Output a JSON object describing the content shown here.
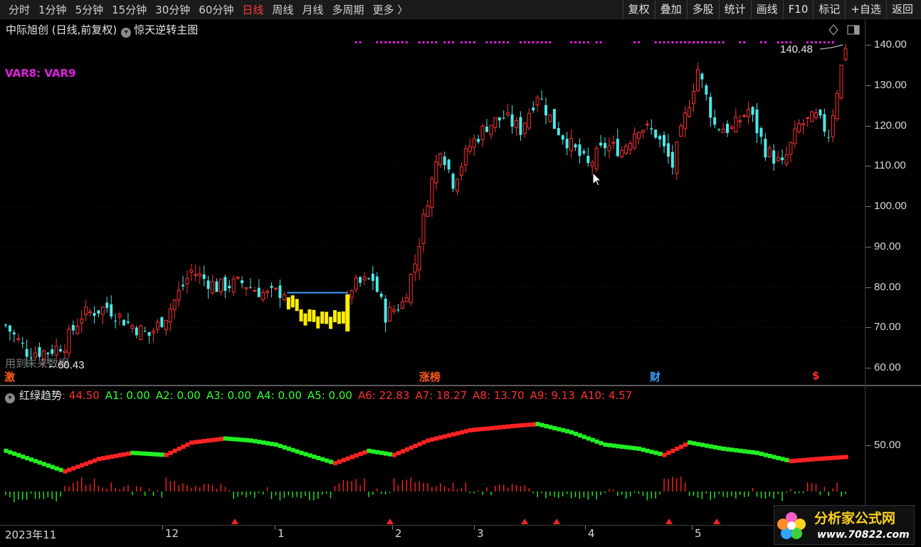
{
  "toolbar": {
    "periods": [
      "分时",
      "1分钟",
      "5分钟",
      "15分钟",
      "30分钟",
      "60分钟",
      "日线",
      "周线",
      "月线",
      "多周期",
      "更多 〉"
    ],
    "active": "日线",
    "right_buttons": [
      "复权",
      "叠加",
      "多股",
      "统计",
      "画线",
      "F10",
      "标记",
      "+自选",
      "返回"
    ]
  },
  "main": {
    "title": "中际旭创 (日线,前复权)",
    "indicator": "惊天逆转主图",
    "var_label": "VAR8:  VAR9",
    "high_label": "140.48",
    "low_label": "←60.43",
    "ghost_text": "用到未来数据",
    "events": [
      {
        "text": "激",
        "color": "#ff5a1a"
      },
      {
        "text": "涨榜",
        "color": "#ff5a1a"
      },
      {
        "text": "财",
        "color": "#3aa0ff"
      },
      {
        "text": "$",
        "color": "#ff3030"
      }
    ],
    "y_ticks": [
      "140.00",
      "130.00",
      "120.00",
      "110.00",
      "100.00",
      "90.00",
      "80.00",
      "70.00",
      "60.00"
    ]
  },
  "sub": {
    "name": "红绿趋势",
    "values": [
      {
        "k": ":",
        "v": "44.50",
        "c": "#ff3030"
      },
      {
        "k": "A1:",
        "v": "0.00",
        "c": "#30ff30"
      },
      {
        "k": "A2:",
        "v": "0.00",
        "c": "#30ff30"
      },
      {
        "k": "A3:",
        "v": "0.00",
        "c": "#30ff30"
      },
      {
        "k": "A4:",
        "v": "0.00",
        "c": "#30ff30"
      },
      {
        "k": "A5:",
        "v": "0.00",
        "c": "#30ff30"
      },
      {
        "k": "A6:",
        "v": "22.83",
        "c": "#ff3030"
      },
      {
        "k": "A7:",
        "v": "18.27",
        "c": "#ff3030"
      },
      {
        "k": "A8:",
        "v": "13.70",
        "c": "#ff3030"
      },
      {
        "k": "A9:",
        "v": "9.13",
        "c": "#ff3030"
      },
      {
        "k": "A10:",
        "v": "4.57",
        "c": "#ff3030"
      }
    ],
    "y_tick": "50.00"
  },
  "time_axis": [
    "2023年11",
    "12",
    "1",
    "2",
    "3",
    "4",
    "5"
  ],
  "colors": {
    "up": "#ff3333",
    "down": "#4ee8e8",
    "purple": "#e020e0",
    "yellow": "#ffee00",
    "green": "#22ee22",
    "red": "#ff2222"
  },
  "watermark": {
    "name": "分析家公式网",
    "url": "www.70822.com"
  },
  "chart_data": {
    "type": "candlestick",
    "y_range": [
      57,
      144
    ],
    "close_path": [
      {
        "i": 0,
        "p": 70.5
      },
      {
        "i": 5,
        "p": 64
      },
      {
        "i": 10,
        "p": 64
      },
      {
        "i": 14,
        "p": 66
      },
      {
        "i": 18,
        "p": 73
      },
      {
        "i": 24,
        "p": 75
      },
      {
        "i": 29,
        "p": 71
      },
      {
        "i": 34,
        "p": 68
      },
      {
        "i": 38,
        "p": 73
      },
      {
        "i": 44,
        "p": 84
      },
      {
        "i": 50,
        "p": 80
      },
      {
        "i": 56,
        "p": 81
      },
      {
        "i": 62,
        "p": 78
      },
      {
        "i": 66,
        "p": 79
      },
      {
        "i": 70,
        "p": 73
      },
      {
        "i": 76,
        "p": 71
      },
      {
        "i": 80,
        "p": 71
      },
      {
        "i": 82,
        "p": 80
      },
      {
        "i": 87,
        "p": 82
      },
      {
        "i": 90,
        "p": 73
      },
      {
        "i": 94,
        "p": 76
      },
      {
        "i": 97,
        "p": 86
      },
      {
        "i": 100,
        "p": 102
      },
      {
        "i": 103,
        "p": 115
      },
      {
        "i": 106,
        "p": 106
      },
      {
        "i": 110,
        "p": 115
      },
      {
        "i": 114,
        "p": 120
      },
      {
        "i": 118,
        "p": 122
      },
      {
        "i": 122,
        "p": 119
      },
      {
        "i": 126,
        "p": 128
      },
      {
        "i": 130,
        "p": 120
      },
      {
        "i": 134,
        "p": 115
      },
      {
        "i": 138,
        "p": 110
      },
      {
        "i": 142,
        "p": 115
      },
      {
        "i": 146,
        "p": 114
      },
      {
        "i": 150,
        "p": 120
      },
      {
        "i": 154,
        "p": 118
      },
      {
        "i": 158,
        "p": 110
      },
      {
        "i": 161,
        "p": 122
      },
      {
        "i": 164,
        "p": 134
      },
      {
        "i": 168,
        "p": 120
      },
      {
        "i": 172,
        "p": 119
      },
      {
        "i": 176,
        "p": 124
      },
      {
        "i": 180,
        "p": 114
      },
      {
        "i": 184,
        "p": 110
      },
      {
        "i": 188,
        "p": 120
      },
      {
        "i": 192,
        "p": 122
      },
      {
        "i": 195,
        "p": 118
      },
      {
        "i": 199,
        "p": 140
      }
    ],
    "trend_path": [
      {
        "i": 0,
        "v": 57
      },
      {
        "i": 14,
        "v": 47
      },
      {
        "i": 22,
        "v": 53
      },
      {
        "i": 30,
        "v": 56
      },
      {
        "i": 38,
        "v": 55
      },
      {
        "i": 44,
        "v": 61
      },
      {
        "i": 52,
        "v": 63
      },
      {
        "i": 58,
        "v": 62
      },
      {
        "i": 64,
        "v": 60
      },
      {
        "i": 70,
        "v": 56
      },
      {
        "i": 78,
        "v": 51
      },
      {
        "i": 86,
        "v": 57
      },
      {
        "i": 92,
        "v": 55
      },
      {
        "i": 100,
        "v": 62
      },
      {
        "i": 110,
        "v": 67
      },
      {
        "i": 120,
        "v": 69
      },
      {
        "i": 126,
        "v": 70
      },
      {
        "i": 134,
        "v": 66
      },
      {
        "i": 142,
        "v": 60
      },
      {
        "i": 150,
        "v": 58
      },
      {
        "i": 156,
        "v": 55
      },
      {
        "i": 162,
        "v": 61
      },
      {
        "i": 170,
        "v": 58
      },
      {
        "i": 178,
        "v": 56
      },
      {
        "i": 186,
        "v": 52
      },
      {
        "i": 192,
        "v": 53
      },
      {
        "i": 199,
        "v": 54
      }
    ]
  }
}
